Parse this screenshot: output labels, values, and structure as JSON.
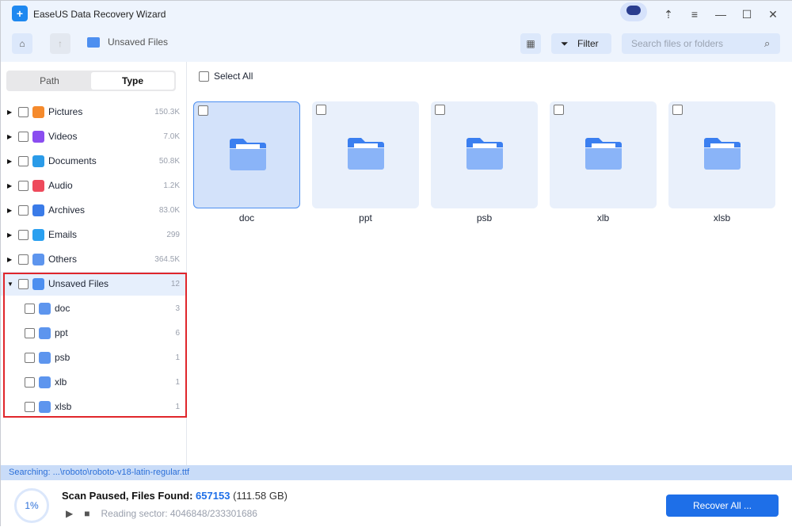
{
  "app": {
    "title": "EaseUS Data Recovery Wizard"
  },
  "toolbar": {
    "breadcrumb": "Unsaved Files",
    "filter_label": "Filter",
    "search_placeholder": "Search files or folders"
  },
  "sidebar": {
    "tabs": [
      {
        "label": "Path"
      },
      {
        "label": "Type"
      }
    ],
    "items": [
      {
        "label": "Pictures",
        "count": "150.3K",
        "color": "#f58a2c"
      },
      {
        "label": "Videos",
        "count": "7.0K",
        "color": "#8a4df0"
      },
      {
        "label": "Documents",
        "count": "50.8K",
        "color": "#2a9be8"
      },
      {
        "label": "Audio",
        "count": "1.2K",
        "color": "#ee4a5c"
      },
      {
        "label": "Archives",
        "count": "83.0K",
        "color": "#3a7be8"
      },
      {
        "label": "Emails",
        "count": "299",
        "color": "#2aa0f0"
      },
      {
        "label": "Others",
        "count": "364.5K",
        "color": "#5d95ee"
      },
      {
        "label": "Unsaved Files",
        "count": "12",
        "color": "#4d8ff0"
      }
    ],
    "children": [
      {
        "label": "doc",
        "count": "3"
      },
      {
        "label": "ppt",
        "count": "6"
      },
      {
        "label": "psb",
        "count": "1"
      },
      {
        "label": "xlb",
        "count": "1"
      },
      {
        "label": "xlsb",
        "count": "1"
      }
    ]
  },
  "main": {
    "select_all": "Select All",
    "tiles": [
      {
        "label": "doc"
      },
      {
        "label": "ppt"
      },
      {
        "label": "psb"
      },
      {
        "label": "xlb"
      },
      {
        "label": "xlsb"
      }
    ]
  },
  "status": {
    "searching": "Searching: ...\\roboto\\roboto-v18-latin-regular.ttf"
  },
  "bottom": {
    "progress": "1%",
    "scan_text": "Scan Paused, Files Found: ",
    "files_found": "657153",
    "size": "(111.58 GB)",
    "sector": "Reading sector: 4046848/233301686",
    "recover_label": "Recover All ..."
  }
}
